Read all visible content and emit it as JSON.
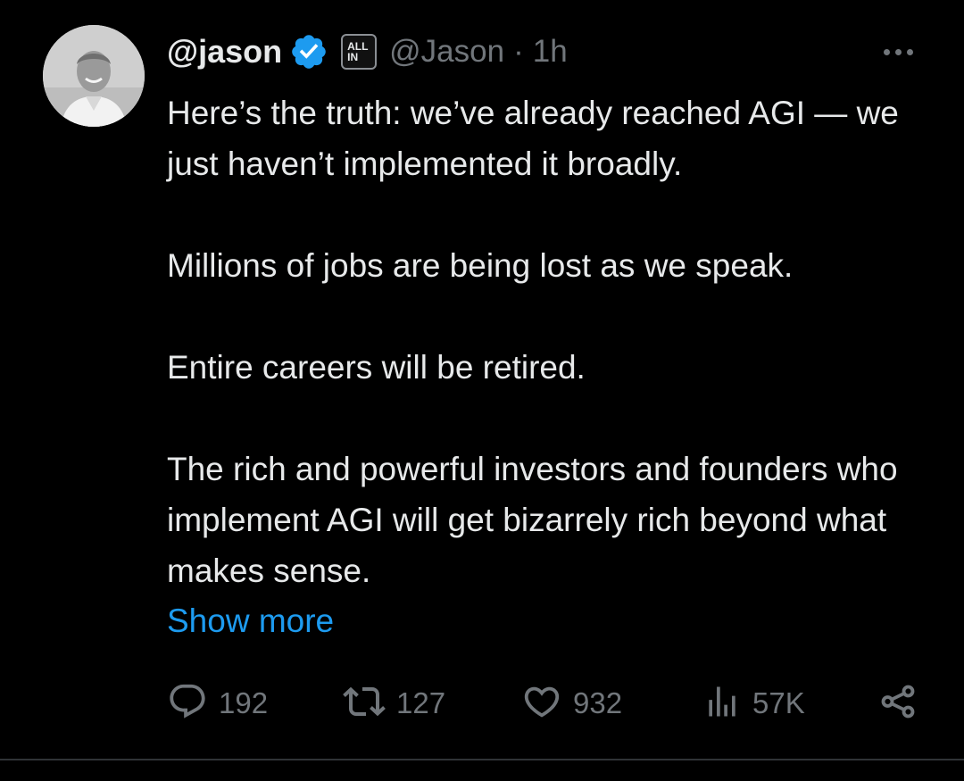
{
  "tweet": {
    "display_name": "@jason",
    "affiliate_badge": [
      "ALL",
      "IN"
    ],
    "handle": "@Jason",
    "separator": "·",
    "time": "1h",
    "paragraphs": [
      "Here’s the truth: we’ve already reached AGI — we just haven’t implemented it broadly.",
      "Millions of jobs are being lost as we speak.",
      "Entire careers will be retired.",
      "The rich and powerful investors and founders who implement AGI will get bizarrely rich beyond what makes sense."
    ],
    "show_more": "Show more"
  },
  "actions": {
    "replies": "192",
    "reposts": "127",
    "likes": "932",
    "views": "57K"
  },
  "icons": {
    "verified": "verified-badge-icon",
    "more": "more-options-icon",
    "reply": "reply-icon",
    "repost": "repost-icon",
    "like": "heart-icon",
    "views": "views-chart-icon",
    "share": "share-icon"
  },
  "colors": {
    "background": "#000000",
    "text": "#e7e9ea",
    "muted": "#71767b",
    "link": "#1d9bf0",
    "verified": "#1d9bf0"
  }
}
